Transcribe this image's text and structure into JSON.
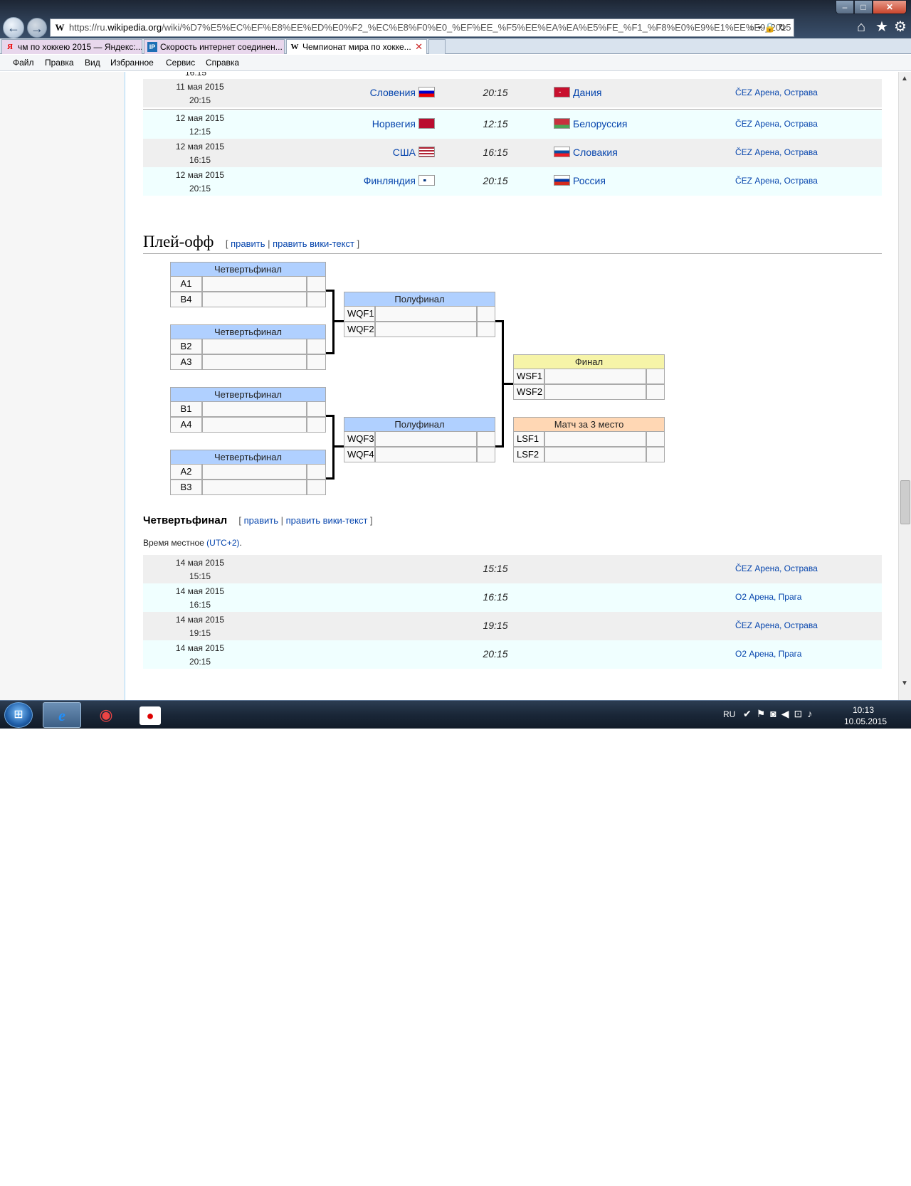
{
  "browser": {
    "url_proto": "https://",
    "url_pre": "ru.",
    "url_domain": "wikipedia.org",
    "url_path": "/wiki/%D7%E5%EC%EF%E8%EE%ED%E0%F2_%EC%E8%F0%E0_%EF%EE_%F5%EE%EA%EA%E5%FE_%F1_%F8%E0%E9%E1%EE%E9_2015",
    "tabs": [
      {
        "label": "чм по хоккею 2015 — Яндекс:...",
        "icon": "yandex-icon"
      },
      {
        "label": "Скорость интернет соединен...",
        "icon": "ip-icon"
      },
      {
        "label": "Чемпионат мира по хокке...",
        "icon": "wikipedia-icon"
      }
    ],
    "menu": [
      "Файл",
      "Правка",
      "Вид",
      "Избранное",
      "Сервис",
      "Справка"
    ]
  },
  "group_games": {
    "fragment_time": "16:15",
    "rows": [
      {
        "date": "11 мая 2015",
        "clock": "20:15",
        "home": "Словения",
        "time": "20:15",
        "away": "Дания",
        "venue": "ČEZ Арена, Острава"
      },
      {
        "date": "12 мая 2015",
        "clock": "12:15",
        "home": "Норвегия",
        "time": "12:15",
        "away": "Белоруссия",
        "venue": "ČEZ Арена, Острава"
      },
      {
        "date": "12 мая 2015",
        "clock": "16:15",
        "home": "США",
        "time": "16:15",
        "away": "Словакия",
        "venue": "ČEZ Арена, Острава"
      },
      {
        "date": "12 мая 2015",
        "clock": "20:15",
        "home": "Финляндия",
        "time": "20:15",
        "away": "Россия",
        "venue": "ČEZ Арена, Острава"
      }
    ]
  },
  "playoff": {
    "title": "Плей-офф",
    "edit": "править",
    "edit_wiki": "править вики-текст",
    "bracket": {
      "qf_label": "Четвертьфинал",
      "sf_label": "Полуфинал",
      "final_label": "Финал",
      "third_label": "Матч за 3 место",
      "qf": [
        [
          "A1",
          "B4"
        ],
        [
          "B2",
          "A3"
        ],
        [
          "B1",
          "A4"
        ],
        [
          "A2",
          "B3"
        ]
      ],
      "sf": [
        [
          "WQF1",
          "WQF2"
        ],
        [
          "WQF3",
          "WQF4"
        ]
      ],
      "final": [
        "WSF1",
        "WSF2"
      ],
      "third": [
        "LSF1",
        "LSF2"
      ]
    }
  },
  "quarterfinal": {
    "title": "Четвертьфинал",
    "edit": "править",
    "edit_wiki": "править вики-текст",
    "tz_prefix": "Время местное ",
    "tz_link": "(UTC+2)",
    "tz_suffix": ".",
    "rows": [
      {
        "date": "14 мая 2015",
        "clock": "15:15",
        "time": "15:15",
        "venue": "ČEZ Арена, Острава"
      },
      {
        "date": "14 мая 2015",
        "clock": "16:15",
        "time": "16:15",
        "venue": "O2 Арена, Прага"
      },
      {
        "date": "14 мая 2015",
        "clock": "19:15",
        "time": "19:15",
        "venue": "ČEZ Арена, Острава"
      },
      {
        "date": "14 мая 2015",
        "clock": "20:15",
        "time": "20:15",
        "venue": "O2 Арена, Прага"
      }
    ]
  },
  "taskbar": {
    "lang": "RU",
    "time": "10:13",
    "date": "10.05.2015"
  }
}
